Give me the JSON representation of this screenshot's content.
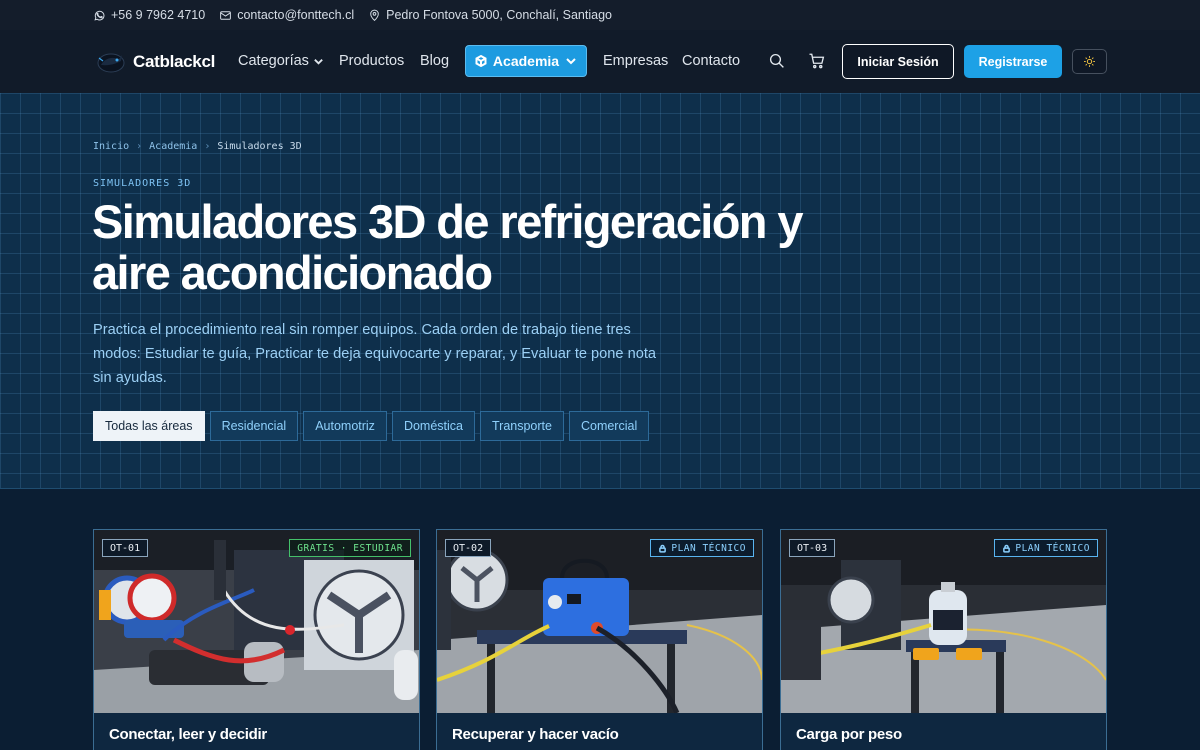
{
  "topbar": {
    "phone": "+56 9 7962 4710",
    "email": "contacto@fonttech.cl",
    "address": "Pedro Fontova 5000, Conchalí, Santiago"
  },
  "nav": {
    "brand": "Catblackcl",
    "links": [
      "Categorías",
      "Productos",
      "Blog",
      "Academia",
      "Empresas",
      "Contacto"
    ],
    "login": "Iniciar Sesión",
    "register": "Registrarse",
    "icons": [
      "search-icon",
      "cart-icon",
      "sun-icon"
    ]
  },
  "hero": {
    "breadcrumb": [
      "Inicio",
      "Academia",
      "Simuladores 3D"
    ],
    "eyebrow": "SIMULADORES 3D",
    "title": "Simuladores 3D de refrigeración y aire acondicionado",
    "description": "Practica el procedimiento real sin romper equipos. Cada orden de trabajo tiene tres modos: Estudiar te guía, Practicar te deja equivocarte y reparar, y Evaluar te pone nota sin ayudas.",
    "filters": [
      "Todas las áreas",
      "Residencial",
      "Automotriz",
      "Doméstica",
      "Transporte",
      "Comercial"
    ],
    "active_filter": "Todas las áreas"
  },
  "cards": [
    {
      "code": "OT-01",
      "badge": "GRATIS · ESTUDIAR",
      "badge_type": "free",
      "title": "Conectar, leer y decidir"
    },
    {
      "code": "OT-02",
      "badge": "PLAN TÉCNICO",
      "badge_type": "plan",
      "title": "Recuperar y hacer vacío"
    },
    {
      "code": "OT-03",
      "badge": "PLAN TÉCNICO",
      "badge_type": "plan",
      "title": "Carga por peso"
    }
  ],
  "colors": {
    "accent": "#1da1e6",
    "hero_bg": "#0e2f4b",
    "nav_bg": "#111b29",
    "free_badge": "#44c06a"
  }
}
